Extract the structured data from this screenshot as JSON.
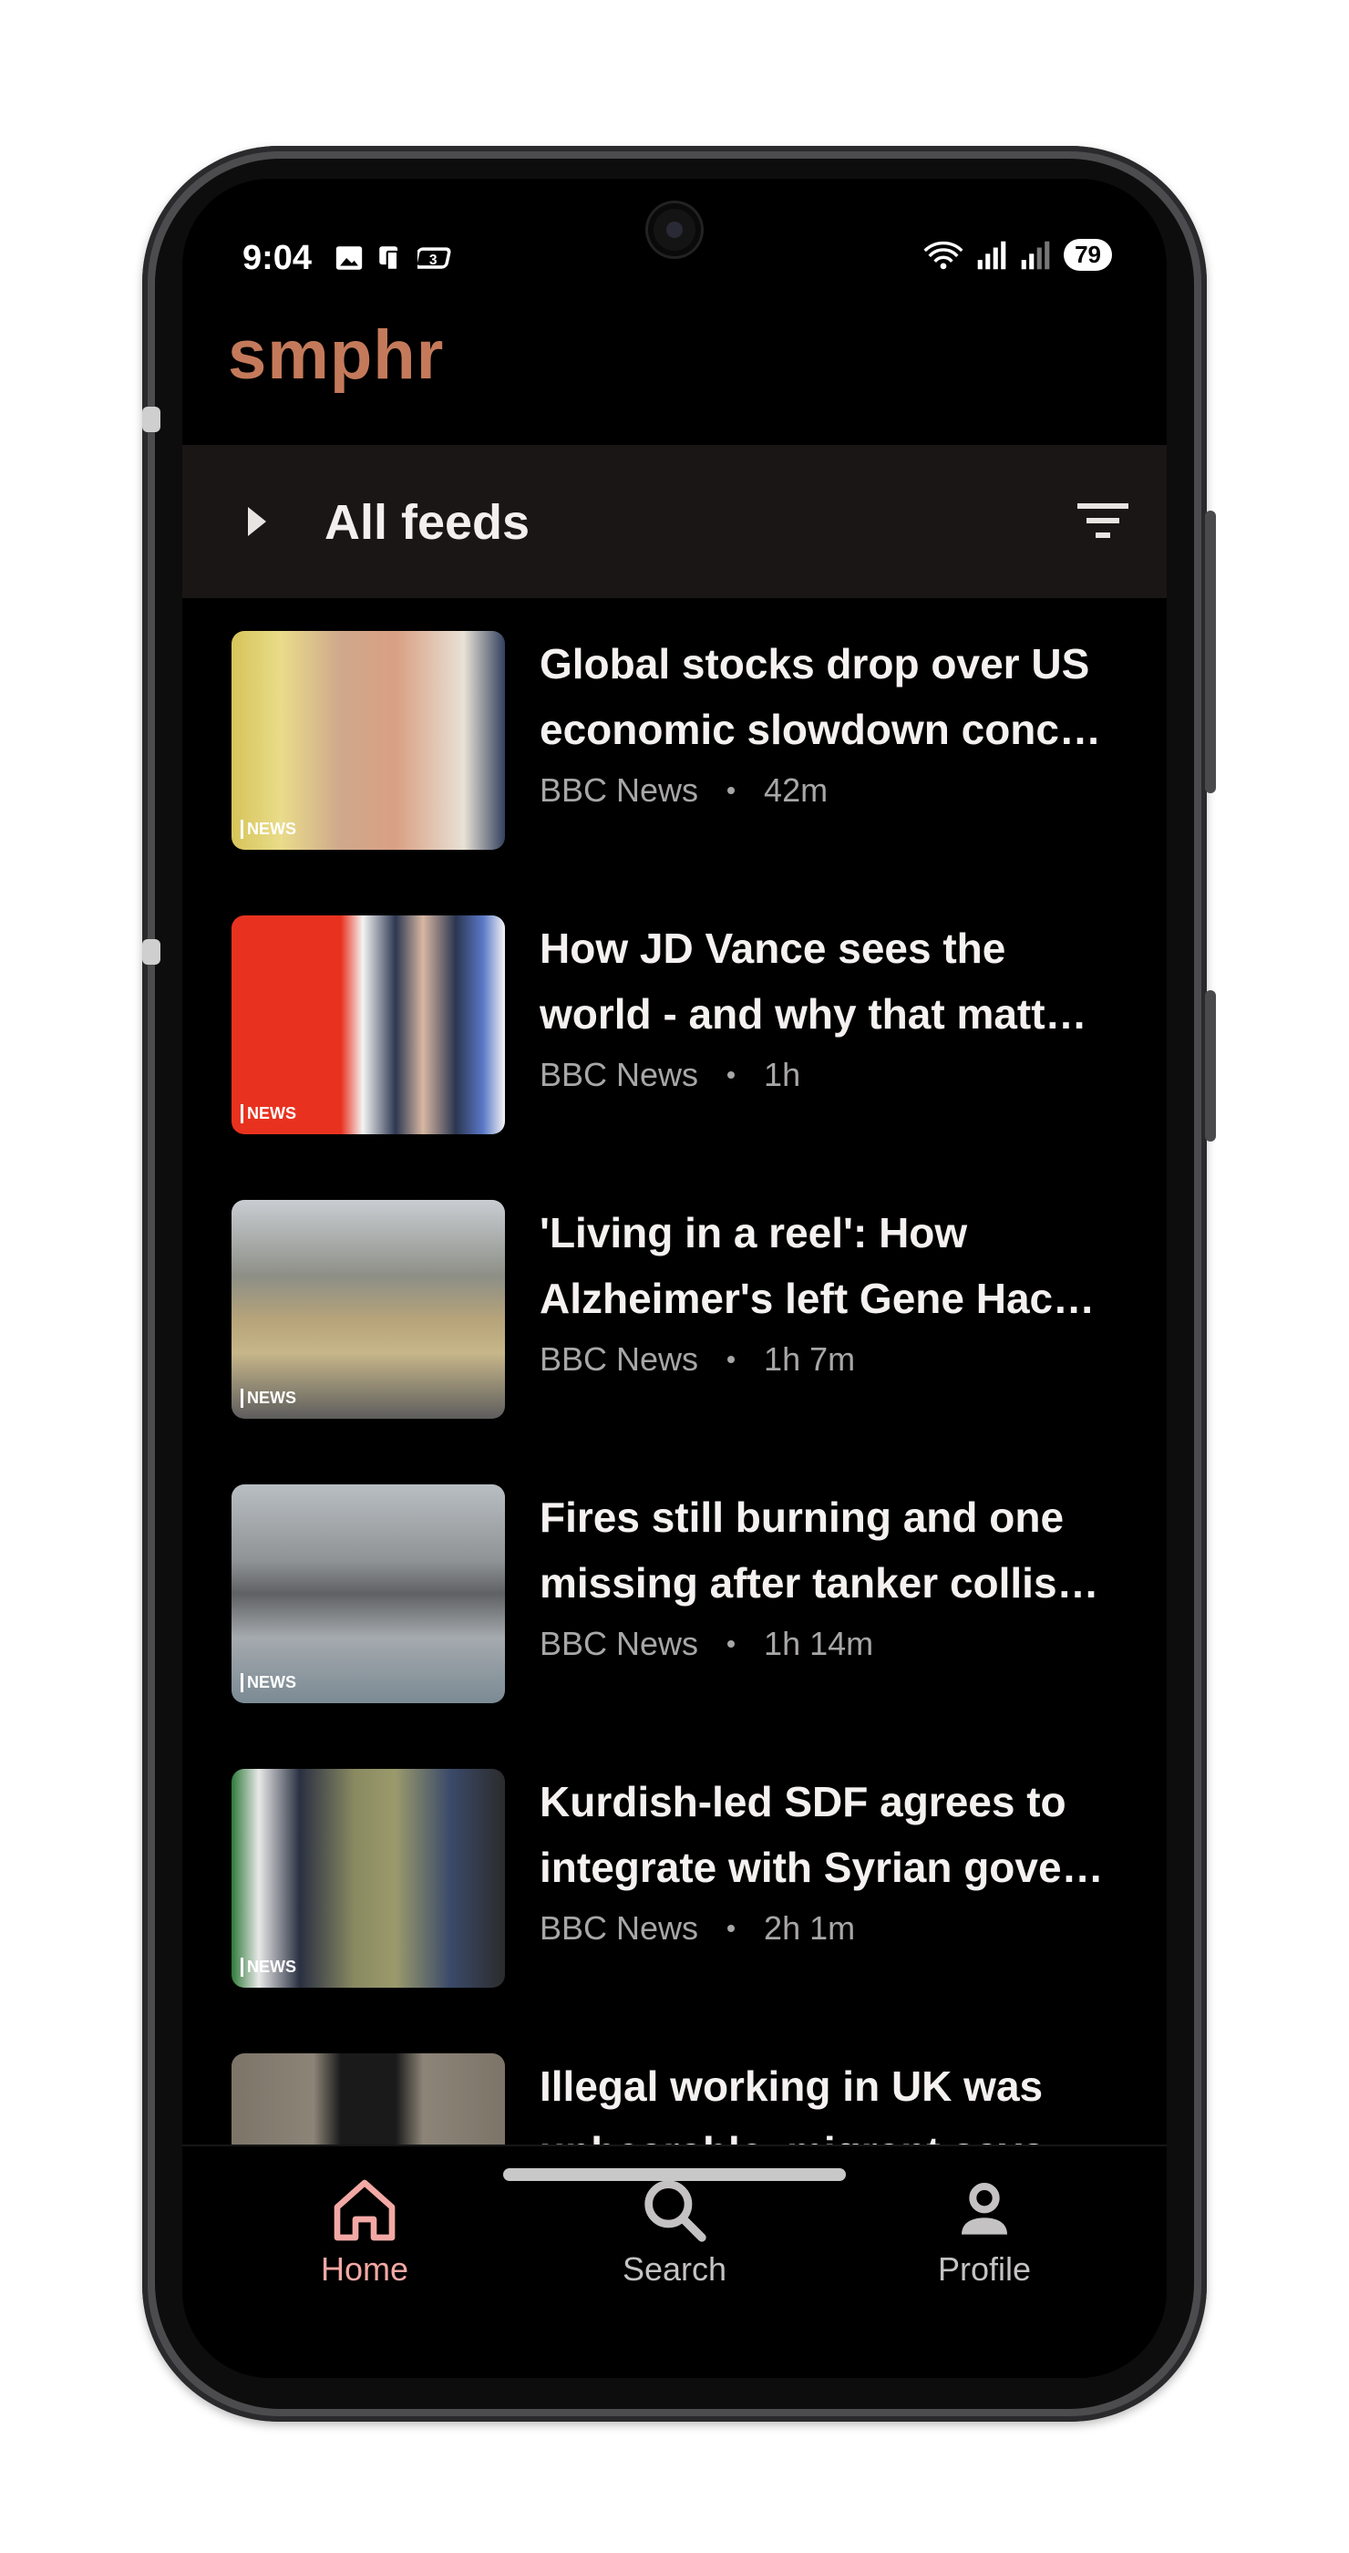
{
  "status_bar": {
    "time": "9:04",
    "battery": "79",
    "left_icons": [
      "image-icon",
      "device-icon",
      "app-icon"
    ],
    "right_icons": [
      "wifi-icon",
      "signal-icon",
      "signal-icon"
    ]
  },
  "app": {
    "title": "smphr",
    "accent_color": "#c47a5a"
  },
  "feed_bar": {
    "title": "All feeds"
  },
  "articles": [
    {
      "title_line1": "Global stocks drop over US",
      "title_line2": "economic slowdown conc…",
      "source": "BBC News",
      "age": "42m",
      "thumb_badge": "NEWS"
    },
    {
      "title_line1": "How JD Vance sees the",
      "title_line2": "world - and why that matt…",
      "source": "BBC News",
      "age": "1h",
      "thumb_badge": "NEWS"
    },
    {
      "title_line1": "'Living in a reel': How",
      "title_line2": "Alzheimer's left Gene Hac…",
      "source": "BBC News",
      "age": "1h 7m",
      "thumb_badge": "NEWS"
    },
    {
      "title_line1": "Fires still burning and one",
      "title_line2": "missing after tanker collis…",
      "source": "BBC News",
      "age": "1h 14m",
      "thumb_badge": "NEWS"
    },
    {
      "title_line1": "Kurdish-led SDF agrees to",
      "title_line2": "integrate with Syrian gove…",
      "source": "BBC News",
      "age": "2h 1m",
      "thumb_badge": "NEWS"
    },
    {
      "title_line1": "Illegal working in UK was",
      "title_line2": "unbearable, migrant says",
      "source": "",
      "age": "",
      "thumb_badge": ""
    }
  ],
  "bottom_nav": {
    "home": "Home",
    "search": "Search",
    "profile": "Profile",
    "active_color": "#f2a8a4",
    "inactive_color": "#c4c2c2"
  }
}
